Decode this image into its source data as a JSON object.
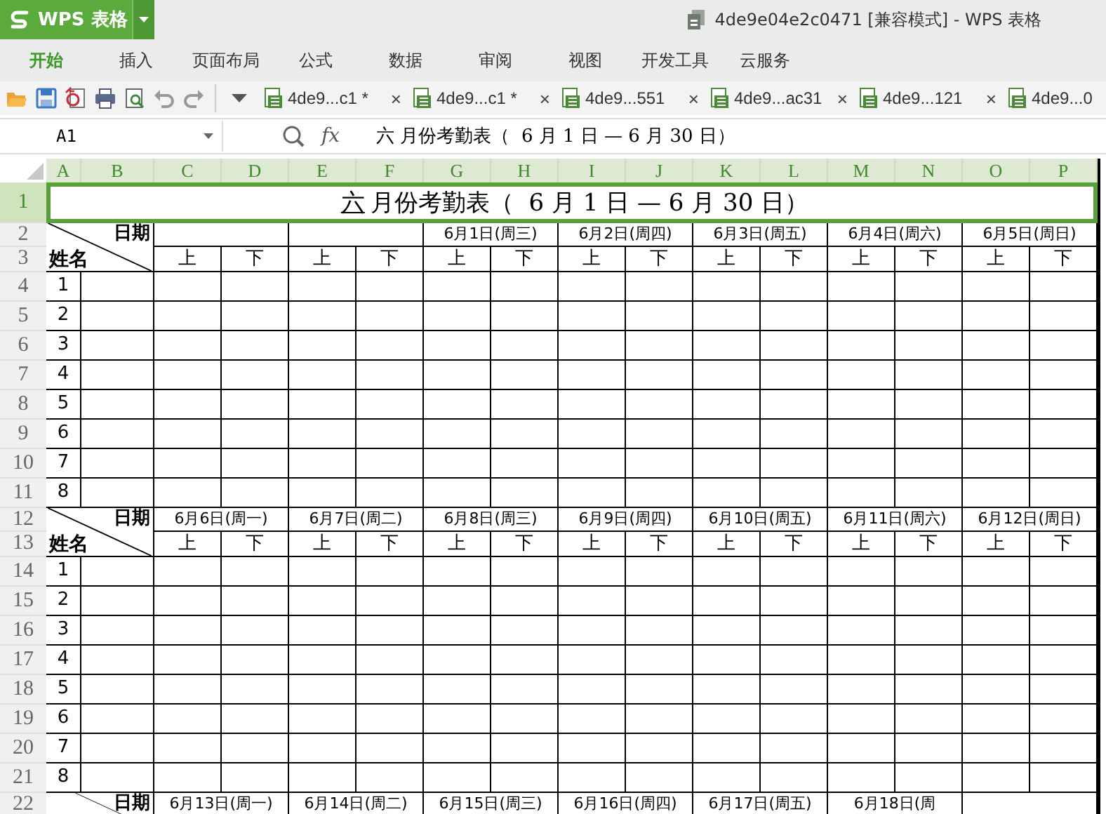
{
  "app": {
    "name": "WPS 表格",
    "title": "4de9e04e2c0471 [兼容模式] - WPS 表格"
  },
  "ribbon_tabs": [
    {
      "label": "开始",
      "selected": true
    },
    {
      "label": "插入",
      "selected": false
    },
    {
      "label": "页面布局",
      "selected": false
    },
    {
      "label": "公式",
      "selected": false
    },
    {
      "label": "数据",
      "selected": false
    },
    {
      "label": "审阅",
      "selected": false
    },
    {
      "label": "视图",
      "selected": false
    },
    {
      "label": "开发工具",
      "selected": false
    },
    {
      "label": "云服务",
      "selected": false
    }
  ],
  "doc_tabs": [
    {
      "label": "4de9...c1 *",
      "close": "×"
    },
    {
      "label": "4de9...c1 *",
      "close": "×"
    },
    {
      "label": "4de9...551",
      "close": "×"
    },
    {
      "label": "4de9...ac31",
      "close": "×"
    },
    {
      "label": "4de9...121",
      "close": "×"
    },
    {
      "label": "4de9...0"
    }
  ],
  "formula_bar": {
    "name_box": "A1",
    "fx": "fx",
    "formula": "六 月份考勤表（  6 月 1 日 — 6 月 30 日）"
  },
  "columns": [
    {
      "label": "A",
      "selected": true
    },
    {
      "label": "B",
      "selected": true
    },
    {
      "label": "C",
      "selected": true
    },
    {
      "label": "D",
      "selected": true
    },
    {
      "label": "E",
      "selected": true
    },
    {
      "label": "F",
      "selected": true
    },
    {
      "label": "G",
      "selected": true
    },
    {
      "label": "H",
      "selected": true
    },
    {
      "label": "I",
      "selected": true
    },
    {
      "label": "J",
      "selected": true
    },
    {
      "label": "K",
      "selected": true
    },
    {
      "label": "L",
      "selected": true
    },
    {
      "label": "M",
      "selected": true
    },
    {
      "label": "N",
      "selected": true
    },
    {
      "label": "O",
      "selected": true
    },
    {
      "label": "P",
      "selected": true
    }
  ],
  "row_headers": [
    {
      "label": "1",
      "selected": true
    },
    {
      "label": "2",
      "selected": false
    },
    {
      "label": "3",
      "selected": false
    },
    {
      "label": "4",
      "selected": false
    },
    {
      "label": "5",
      "selected": false
    },
    {
      "label": "6",
      "selected": false
    },
    {
      "label": "7",
      "selected": false
    },
    {
      "label": "8",
      "selected": false
    },
    {
      "label": "9",
      "selected": false
    },
    {
      "label": "10",
      "selected": false
    },
    {
      "label": "11",
      "selected": false
    },
    {
      "label": "12",
      "selected": false
    },
    {
      "label": "13",
      "selected": false
    },
    {
      "label": "14",
      "selected": false
    },
    {
      "label": "15",
      "selected": false
    },
    {
      "label": "16",
      "selected": false
    },
    {
      "label": "17",
      "selected": false
    },
    {
      "label": "18",
      "selected": false
    },
    {
      "label": "19",
      "selected": false
    },
    {
      "label": "20",
      "selected": false
    },
    {
      "label": "21",
      "selected": false
    },
    {
      "label": "22",
      "selected": false
    }
  ],
  "title": {
    "blank": "六",
    "text": "月份考勤表（  6 月 1 日 — 6 月 30 日）",
    "selected": true
  },
  "blocks": [
    {
      "corner_date": "日期",
      "corner_name": "姓名",
      "dates": [
        {
          "kind": "blank"
        },
        {
          "kind": "blank"
        },
        {
          "kind": "date",
          "label": "6月1日(周三)"
        },
        {
          "kind": "date",
          "label": "6月2日(周四)"
        },
        {
          "kind": "date",
          "label": "6月3日(周五)"
        },
        {
          "kind": "date",
          "label": "6月4日(周六)"
        },
        {
          "kind": "date",
          "label": "6月5日(周日)"
        }
      ],
      "halves": [
        "上",
        "下",
        "上",
        "下",
        "上",
        "下",
        "上",
        "下",
        "上",
        "下",
        "上",
        "下",
        "上",
        "下"
      ],
      "numbers": [
        "1",
        "2",
        "3",
        "4",
        "5",
        "6",
        "7",
        "8"
      ]
    },
    {
      "corner_date": "日期",
      "corner_name": "姓名",
      "dates": [
        {
          "kind": "date",
          "label": "6月6日(周一)"
        },
        {
          "kind": "date",
          "label": "6月7日(周二)"
        },
        {
          "kind": "date",
          "label": "6月8日(周三)"
        },
        {
          "kind": "date",
          "label": "6月9日(周四)"
        },
        {
          "kind": "date",
          "label": "6月10日(周五)"
        },
        {
          "kind": "date",
          "label": "6月11日(周六)"
        },
        {
          "kind": "date",
          "label": "6月12日(周日)"
        }
      ],
      "halves": [
        "上",
        "下",
        "上",
        "下",
        "上",
        "下",
        "上",
        "下",
        "上",
        "下",
        "上",
        "下",
        "上",
        "下"
      ],
      "numbers": [
        "1",
        "2",
        "3",
        "4",
        "5",
        "6",
        "7",
        "8"
      ]
    },
    {
      "corner_date": "日期",
      "dates": [
        {
          "kind": "date",
          "label": "6月13日(周一)"
        },
        {
          "kind": "date",
          "label": "6月14日(周二)"
        },
        {
          "kind": "date",
          "label": "6月15日(周三)"
        },
        {
          "kind": "date",
          "label": "6月16日(周四)"
        },
        {
          "kind": "date",
          "label": "6月17日(周五)"
        },
        {
          "kind": "date",
          "label": "6月18日(周"
        }
      ]
    }
  ]
}
